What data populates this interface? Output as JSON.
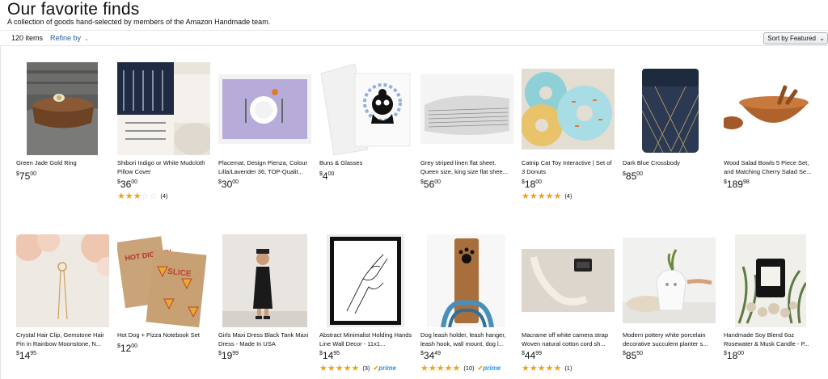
{
  "header": {
    "title": "Our favorite finds",
    "subtitle": "A collection of goods hand-selected by members of the Amazon Handmade team."
  },
  "toolbar": {
    "item_count": "120 items",
    "refine_label": "Refine by",
    "sort_label": "Sort by",
    "sort_value": "Featured"
  },
  "products": [
    {
      "title": "Green Jade Gold Ring",
      "price_symbol": "$",
      "price_whole": "75",
      "price_fraction": "00"
    },
    {
      "title": "Shibori Indigo or White Mudcloth Pillow Cover",
      "price_symbol": "$",
      "price_whole": "36",
      "price_fraction": "00",
      "stars": "★★★☆☆",
      "review_count": "(4)"
    },
    {
      "title": "Placemat, Design Pienza, Colour Lilla/Lavender 36, TOP-Qualit...",
      "price_symbol": "$",
      "price_whole": "30",
      "price_fraction": "00"
    },
    {
      "title": "Buns & Glasses",
      "price_symbol": "$",
      "price_whole": "4",
      "price_fraction": "00"
    },
    {
      "title": "Grey striped linen flat sheet. Queen size, king size flat shee...",
      "price_symbol": "$",
      "price_whole": "56",
      "price_fraction": "00"
    },
    {
      "title": "Catnip Cat Toy Interactive | Set of 3 Donuts",
      "price_symbol": "$",
      "price_whole": "18",
      "price_fraction": "00",
      "stars": "★★★★★",
      "review_count": "(4)"
    },
    {
      "title": "Dark Blue Crossbody",
      "price_symbol": "$",
      "price_whole": "85",
      "price_fraction": "00"
    },
    {
      "title": "Wood Salad Bowls 5 Piece Set, and Matching Cherry Salad Se...",
      "price_symbol": "$",
      "price_whole": "189",
      "price_fraction": "98"
    },
    {
      "title": "Crystal Hair Clip, Gemstone Hair Pin in Rainbow Moonstone, N...",
      "price_symbol": "$",
      "price_whole": "14",
      "price_fraction": "95"
    },
    {
      "title": "Hot Dog + Pizza Notebook Set",
      "price_symbol": "$",
      "price_whole": "12",
      "price_fraction": "00"
    },
    {
      "title": "Girls Maxi Dress Black Tank Maxi Dress - Made In USA",
      "price_symbol": "$",
      "price_whole": "19",
      "price_fraction": "99"
    },
    {
      "title": "Abstract Minimalist Holding Hands Line Wall Decor - 11x1...",
      "price_symbol": "$",
      "price_whole": "14",
      "price_fraction": "95",
      "stars": "★★★★★",
      "review_count": "(3)",
      "prime": "prime"
    },
    {
      "title": "Dog leash holder, leash hanger, leash hook, wall mount, dog l...",
      "price_symbol": "$",
      "price_whole": "34",
      "price_fraction": "49",
      "stars": "★★★★★",
      "review_count": "(10)",
      "prime": "prime"
    },
    {
      "title": "Macrame off white camera strap Woven natural cotton cord sh...",
      "price_symbol": "$",
      "price_whole": "44",
      "price_fraction": "99",
      "stars": "★★★★★",
      "review_count": "(1)"
    },
    {
      "title": "Modern pottery white porcelain decorative succulent planter s...",
      "price_symbol": "$",
      "price_whole": "85",
      "price_fraction": "50"
    },
    {
      "title": "Handmade Soy Blend 6oz Rosewater & Musk Candle - P...",
      "price_symbol": "$",
      "price_whole": "18",
      "price_fraction": "00"
    }
  ]
}
